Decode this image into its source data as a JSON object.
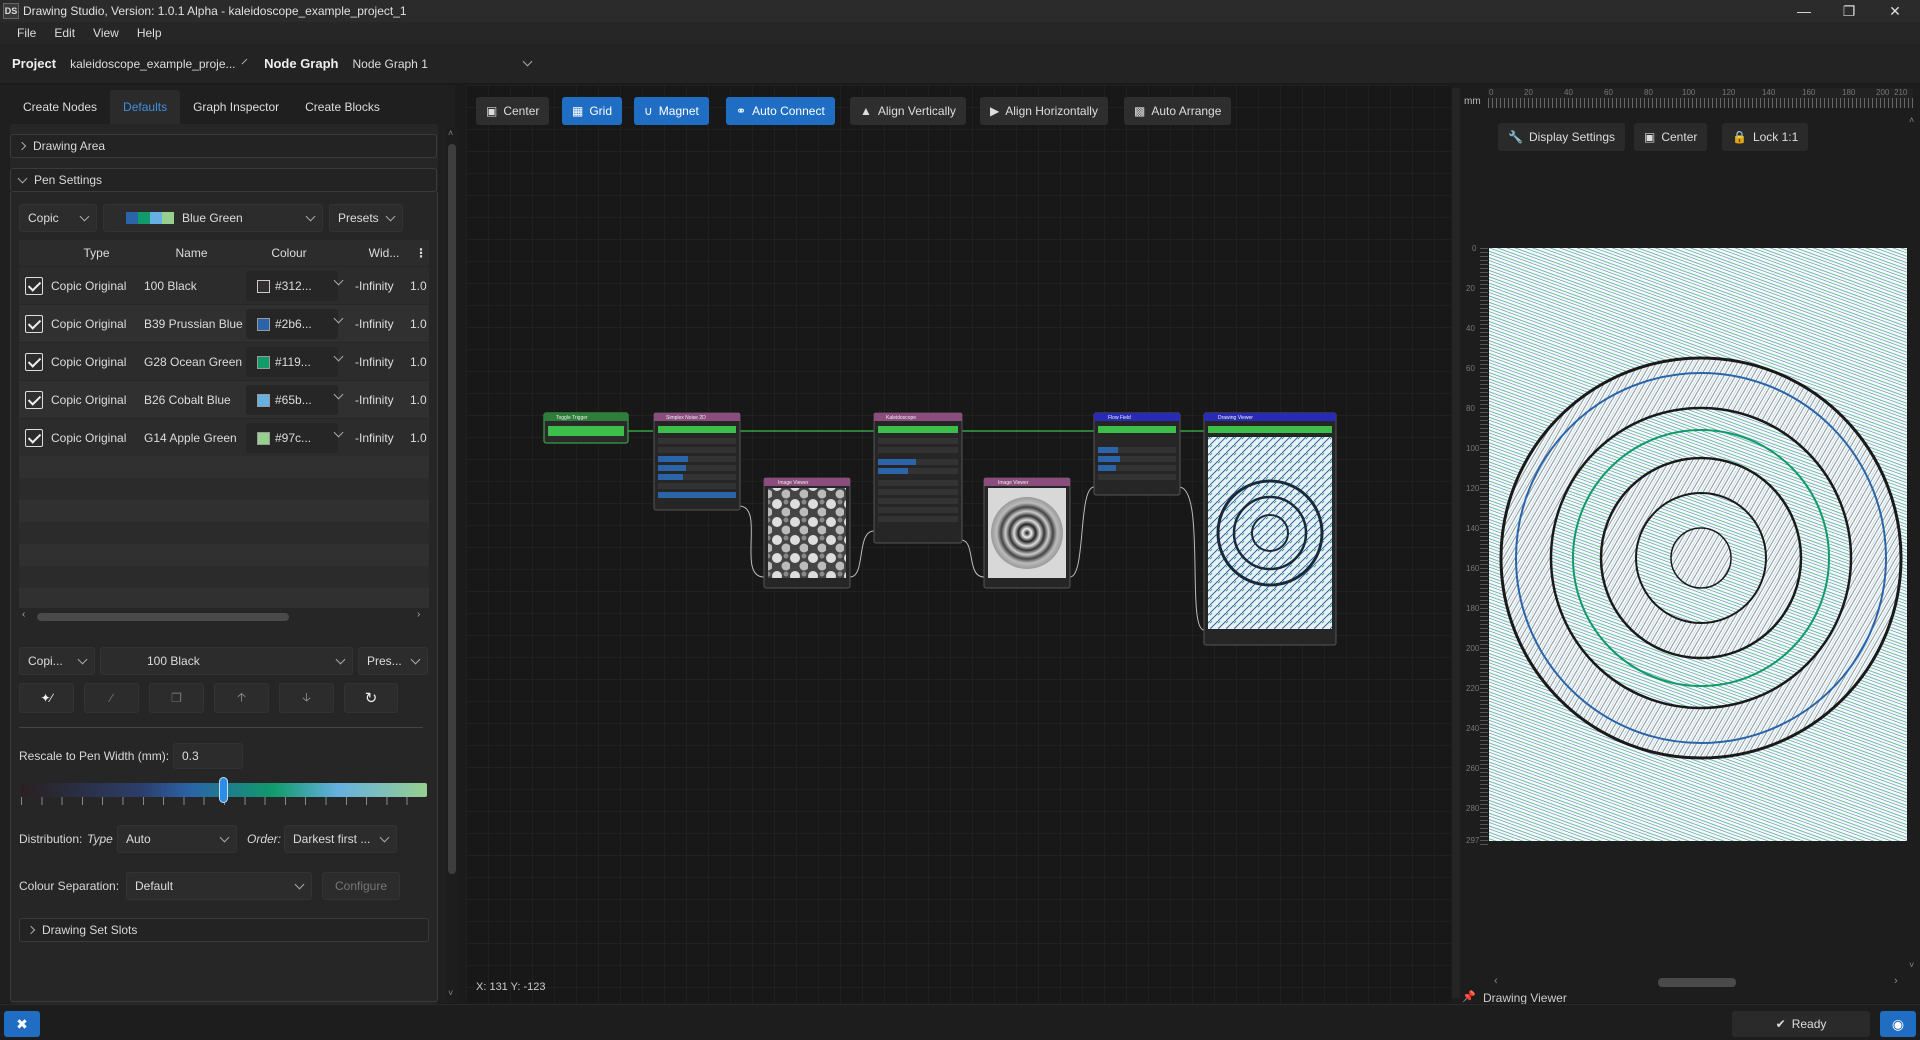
{
  "window": {
    "app_icon": "DS",
    "title": "Drawing Studio, Version: 1.0.1 Alpha - kaleidoscope_example_project_1",
    "controls": [
      "minimize-icon",
      "restore-icon",
      "close-icon"
    ]
  },
  "menu": [
    "File",
    "Edit",
    "View",
    "Help"
  ],
  "projectbar": {
    "project_label": "Project",
    "project_value": "kaleidoscope_example_proje...",
    "nodegraph_label": "Node Graph",
    "nodegraph_value": "Node Graph 1"
  },
  "left": {
    "tabs": [
      "Create Nodes",
      "Defaults",
      "Graph Inspector",
      "Create Blocks"
    ],
    "active_tab": 1,
    "drawing_area": "Drawing Area",
    "pen_settings": "Pen Settings",
    "pen_brand": "Copic",
    "palette": "Blue Green",
    "presets": "Presets",
    "table": {
      "headers": [
        "Type",
        "Name",
        "Colour",
        "Wid..."
      ],
      "rows": [
        {
          "type": "Copic Original",
          "name": "100 Black",
          "colour": "#312...",
          "swatch": "#312f2f",
          "min": "-Infinity",
          "width": "1.0"
        },
        {
          "type": "Copic Original",
          "name": "B39 Prussian Blue",
          "colour": "#2b6...",
          "swatch": "#2b64a8",
          "min": "-Infinity",
          "width": "1.0"
        },
        {
          "type": "Copic Original",
          "name": "G28 Ocean Green",
          "colour": "#119...",
          "swatch": "#119a6a",
          "min": "-Infinity",
          "width": "1.0"
        },
        {
          "type": "Copic Original",
          "name": "B26 Cobalt Blue",
          "colour": "#65b...",
          "swatch": "#65b0e0",
          "min": "-Infinity",
          "width": "1.0"
        },
        {
          "type": "Copic Original",
          "name": "G14 Apple Green",
          "colour": "#97c...",
          "swatch": "#97cf8f",
          "min": "-Infinity",
          "width": "1.0"
        }
      ]
    },
    "pen_brand2": "Copi...",
    "pen_select": "100 Black",
    "presets2": "Pres...",
    "rescale_label": "Rescale to Pen Width (mm):",
    "rescale_value": "0.3",
    "distribution_label": "Distribution:",
    "type_label": "Type",
    "type_value": "Auto",
    "order_label": "Order:",
    "order_value": "Darkest first ...",
    "colour_sep_label": "Colour Separation:",
    "colour_sep_value": "Default",
    "configure": "Configure",
    "drawing_set_slots": "Drawing Set Slots"
  },
  "graph_toolbar": [
    {
      "label": "Center",
      "icon": "center-icon",
      "on": false
    },
    {
      "label": "Grid",
      "icon": "grid-icon",
      "on": true
    },
    {
      "label": "Magnet",
      "icon": "magnet-icon",
      "on": true
    },
    {
      "label": "Auto Connect",
      "icon": "link-icon",
      "on": true
    },
    {
      "label": "Align Vertically",
      "icon": "align-vertical-icon",
      "on": false
    },
    {
      "label": "Align Horizontally",
      "icon": "align-horizontal-icon",
      "on": false
    },
    {
      "label": "Auto Arrange",
      "icon": "auto-arrange-icon",
      "on": false
    }
  ],
  "graph": {
    "coords": "X: 131 Y: -123",
    "nodes": {
      "trigger": "Toggle Trigger",
      "noise": "Simplex Noise 2D",
      "viewer1": "Image Viewer",
      "kaleido": "Kaleidoscope",
      "viewer2": "Image Viewer",
      "flowfield": "Flow Field",
      "drawviewer": "Drawing Viewer"
    }
  },
  "right": {
    "ruler_unit": "mm",
    "buttons": [
      "Display Settings",
      "Center",
      "Lock 1:1"
    ],
    "top_ticks": [
      "0",
      "20",
      "40",
      "60",
      "80",
      "100",
      "120",
      "140",
      "160",
      "180",
      "200",
      "210"
    ],
    "left_ticks": [
      "0",
      "20",
      "40",
      "60",
      "80",
      "100",
      "120",
      "140",
      "160",
      "180",
      "200",
      "220",
      "240",
      "260",
      "280",
      "297"
    ],
    "footer": "Drawing Viewer"
  },
  "status": {
    "ready": "Ready"
  },
  "colors": {
    "accent": "#1f6ec4",
    "node_green": "#3dbd4a",
    "node_purple": "#8a4d7e",
    "node_blue": "#2a2ab8"
  }
}
